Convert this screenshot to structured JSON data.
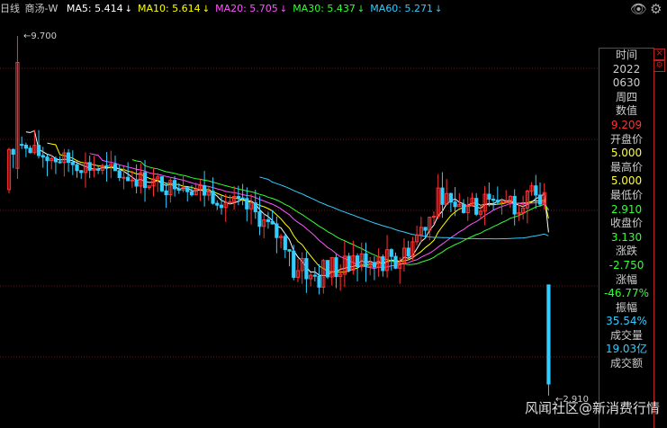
{
  "header": {
    "period": "日线",
    "stock_name": "商汤-W",
    "ma": [
      {
        "label": "MA5: 5.414",
        "color": "#ffffff"
      },
      {
        "label": "MA10: 5.614",
        "color": "#ffff00"
      },
      {
        "label": "MA20: 5.705",
        "color": "#ff55ff"
      },
      {
        "label": "MA30: 5.437",
        "color": "#33ff33"
      },
      {
        "label": "MA60: 5.271",
        "color": "#33ccff"
      }
    ],
    "arrow": "↓",
    "eye_icon": "eye-icon",
    "settings_icon": "gear-icon"
  },
  "chart": {
    "high_label": "9.700",
    "low_label": "2.910"
  },
  "panel": {
    "rows": [
      {
        "text": "时间",
        "color": "#cccccc"
      },
      {
        "text": "2022",
        "color": "#cccccc"
      },
      {
        "text": "0630",
        "color": "#cccccc"
      },
      {
        "text": "周四",
        "color": "#cccccc"
      },
      {
        "text": "数值",
        "color": "#cccccc"
      },
      {
        "text": "9.209",
        "color": "#ff3333"
      },
      {
        "text": "开盘价",
        "color": "#cccccc"
      },
      {
        "text": "5.000",
        "color": "#ffff33"
      },
      {
        "text": "最高价",
        "color": "#cccccc"
      },
      {
        "text": "5.000",
        "color": "#ffff33"
      },
      {
        "text": "最低价",
        "color": "#cccccc"
      },
      {
        "text": "2.910",
        "color": "#33ff33"
      },
      {
        "text": "收盘价",
        "color": "#cccccc"
      },
      {
        "text": "3.130",
        "color": "#33ff33"
      },
      {
        "text": "涨跌",
        "color": "#cccccc"
      },
      {
        "text": "-2.750",
        "color": "#33ff33"
      },
      {
        "text": "涨幅",
        "color": "#cccccc"
      },
      {
        "text": "-46.77%",
        "color": "#33ff33"
      },
      {
        "text": "振幅",
        "color": "#cccccc"
      },
      {
        "text": "35.54%",
        "color": "#33ccff"
      },
      {
        "text": "成交量",
        "color": "#cccccc"
      },
      {
        "text": "19.03亿",
        "color": "#33ccff"
      },
      {
        "text": "成交额",
        "color": "#cccccc"
      }
    ]
  },
  "watermark": "风闻社区@新消费行情",
  "colors": {
    "up": "#ff3333",
    "down": "#33ccff",
    "grid": "#7a1414"
  }
}
